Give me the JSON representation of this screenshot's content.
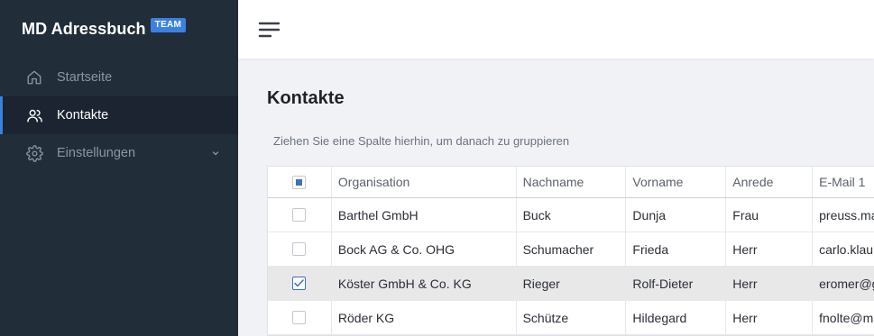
{
  "app": {
    "title": "MD Adressbuch",
    "badge": "TEAM",
    "accent": "#3b82e0",
    "sidebar_bg": "#222d3a"
  },
  "sidebar": {
    "items": [
      {
        "label": "Startseite",
        "icon": "home-icon",
        "active": false
      },
      {
        "label": "Kontakte",
        "icon": "users-icon",
        "active": true
      },
      {
        "label": "Einstellungen",
        "icon": "gear-icon",
        "active": false,
        "expandable": true
      }
    ]
  },
  "topbar": {
    "menu_icon": "hamburger-icon"
  },
  "main": {
    "title": "Kontakte",
    "group_hint": "Ziehen Sie eine Spalte hierhin, um danach zu gruppieren",
    "table": {
      "select_all_state": "partial",
      "columns": [
        "Organisation",
        "Nachname",
        "Vorname",
        "Anrede",
        "E-Mail 1"
      ],
      "rows": [
        {
          "selected": false,
          "organisation": "Barthel GmbH",
          "nachname": "Buck",
          "vorname": "Dunja",
          "anrede": "Frau",
          "email": "preuss.ma"
        },
        {
          "selected": false,
          "organisation": "Bock AG & Co. OHG",
          "nachname": "Schumacher",
          "vorname": "Frieda",
          "anrede": "Herr",
          "email": "carlo.klau"
        },
        {
          "selected": true,
          "organisation": "Köster GmbH & Co. KG",
          "nachname": "Rieger",
          "vorname": "Rolf-Dieter",
          "anrede": "Herr",
          "email": "eromer@g"
        },
        {
          "selected": false,
          "organisation": "Röder KG",
          "nachname": "Schütze",
          "vorname": "Hildegard",
          "anrede": "Herr",
          "email": "fnolte@ma"
        }
      ]
    }
  }
}
